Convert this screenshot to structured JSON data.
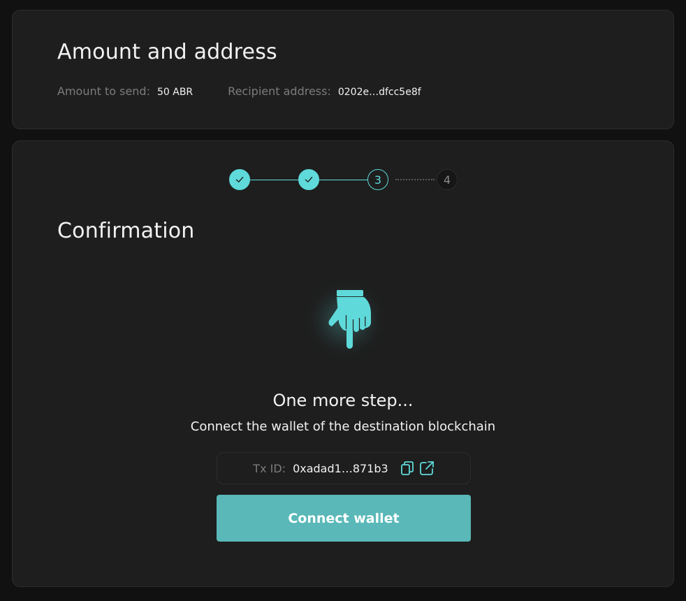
{
  "summary": {
    "title": "Amount and address",
    "amount_label": "Amount to send:",
    "amount_value": "50 ABR",
    "recipient_label": "Recipient address:",
    "recipient_value": "0202e…dfcc5e8f"
  },
  "stepper": {
    "steps": [
      {
        "state": "done",
        "label": ""
      },
      {
        "state": "done",
        "label": ""
      },
      {
        "state": "current",
        "label": "3"
      },
      {
        "state": "future",
        "label": "4"
      }
    ]
  },
  "confirmation": {
    "title": "Confirmation",
    "icon": "pointing-hand-icon",
    "headline": "One more step...",
    "subline": "Connect the wallet of the destination blockchain",
    "txid_label": "Tx ID:",
    "txid_value": "0xadad1…871b3",
    "connect_button": "Connect wallet"
  },
  "colors": {
    "accent": "#5fd9d9",
    "button": "#5ab8b8",
    "card": "#1e1e1e",
    "background": "#111111"
  }
}
